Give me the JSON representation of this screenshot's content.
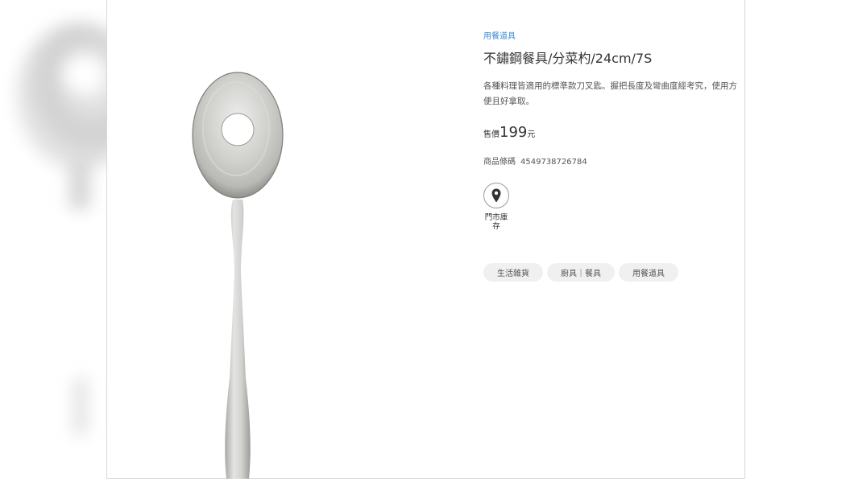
{
  "product": {
    "breadcrumb": "用餐道具",
    "title": "不鏽鋼餐具/分菜杓/24cm/7S",
    "description": "各種料理皆適用的標準款刀叉匙。握把長度及彎曲度經考究，使用方便且好拿取。",
    "price_label": "售價",
    "price_value": "199",
    "price_unit": "元",
    "barcode_label": "商品條碼",
    "barcode_value": "4549738726784"
  },
  "store_stock": {
    "icon": "location-pin-icon",
    "label": "門市庫存"
  },
  "tags": [
    "生活雜貨",
    "廚具｜餐具",
    "用餐道具"
  ]
}
